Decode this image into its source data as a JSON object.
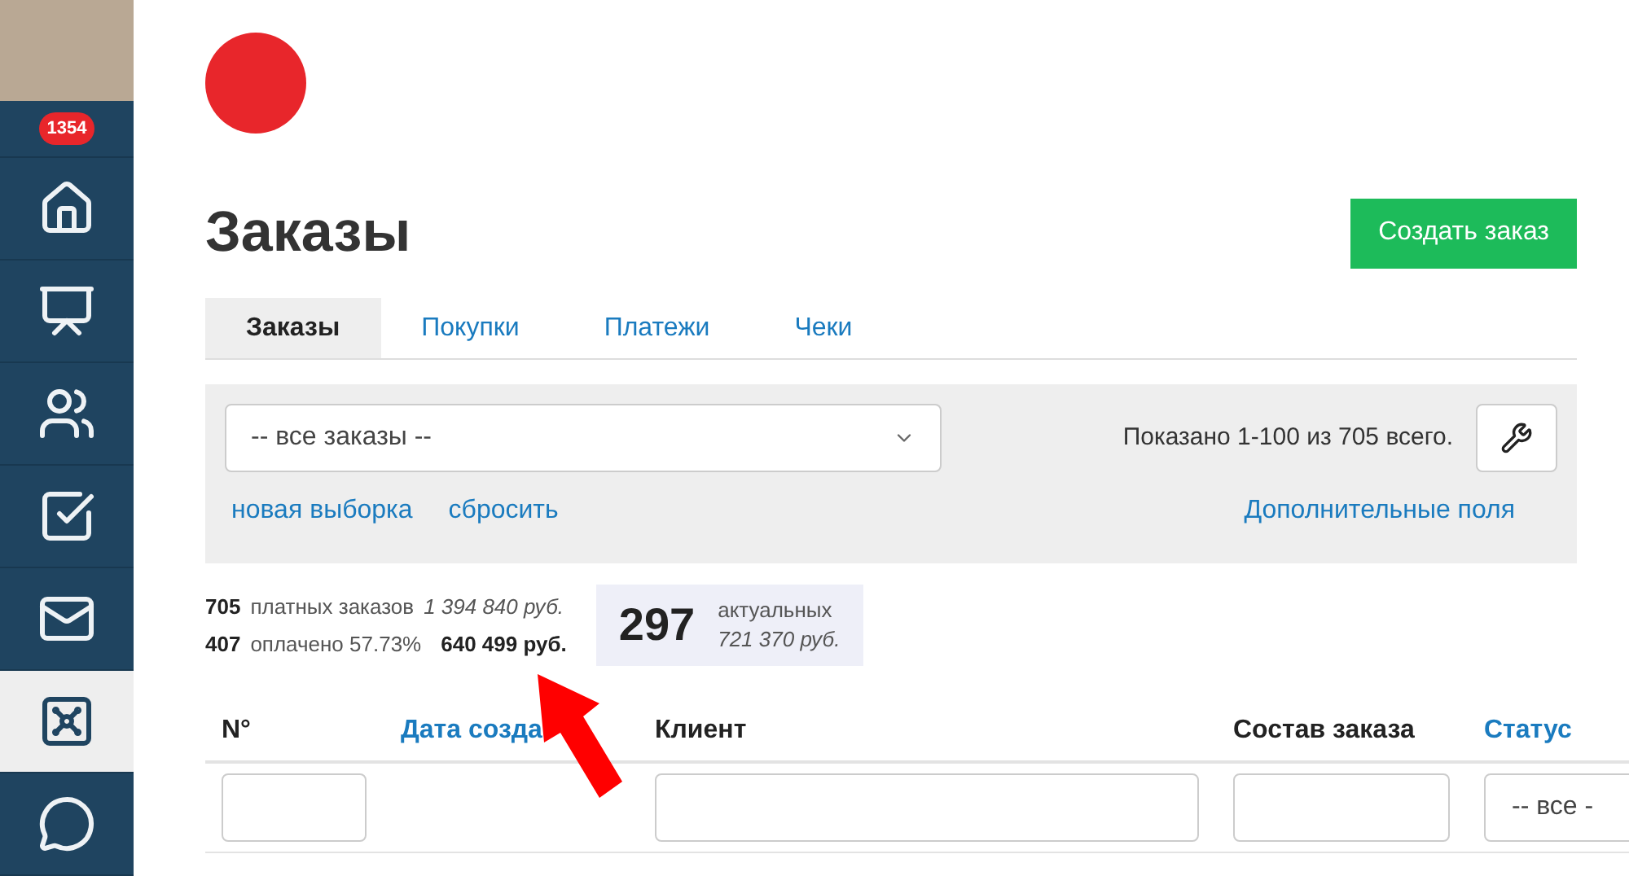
{
  "sidebar": {
    "badge": "1354",
    "items": [
      {
        "kind": "home",
        "selected": false
      },
      {
        "kind": "chart",
        "selected": false
      },
      {
        "kind": "users",
        "selected": false
      },
      {
        "kind": "tasks",
        "selected": false
      },
      {
        "kind": "mail",
        "selected": false
      },
      {
        "kind": "safe",
        "selected": true
      },
      {
        "kind": "chat",
        "selected": false
      }
    ]
  },
  "page": {
    "title": "Заказы",
    "create_button": "Создать заказ"
  },
  "tabs": [
    {
      "label": "Заказы",
      "selected": true
    },
    {
      "label": "Покупки",
      "selected": false
    },
    {
      "label": "Платежи",
      "selected": false
    },
    {
      "label": "Чеки",
      "selected": false
    }
  ],
  "filter": {
    "select": "-- все заказы --",
    "shown": "Показано 1-100 из 705 всего.",
    "links": [
      "новая выборка",
      "сбросить"
    ],
    "extra_fields": "Дополнительные поля"
  },
  "stats": {
    "rows": [
      {
        "count": "705",
        "label": "платных заказов",
        "sum": "1 394 840 руб.",
        "sum_bold": false
      },
      {
        "count": "407",
        "label": "оплачено 57.73%",
        "sum": "640 499 руб.",
        "sum_bold": true
      }
    ],
    "actual": {
      "count": "297",
      "label": "актуальных",
      "sum": "721 370 руб."
    }
  },
  "table": {
    "columns": [
      {
        "label": "N°",
        "sortable": false
      },
      {
        "label": "Дата созда",
        "sortable": true
      },
      {
        "label": "Клиент",
        "sortable": false
      },
      {
        "label": "Состав заказа",
        "sortable": false
      },
      {
        "label": "Статус",
        "sortable": true
      }
    ],
    "filters": [
      {
        "kind": "input"
      },
      {
        "kind": "none"
      },
      {
        "kind": "input"
      },
      {
        "kind": "input"
      },
      {
        "kind": "select",
        "value": "-- все -"
      }
    ]
  }
}
